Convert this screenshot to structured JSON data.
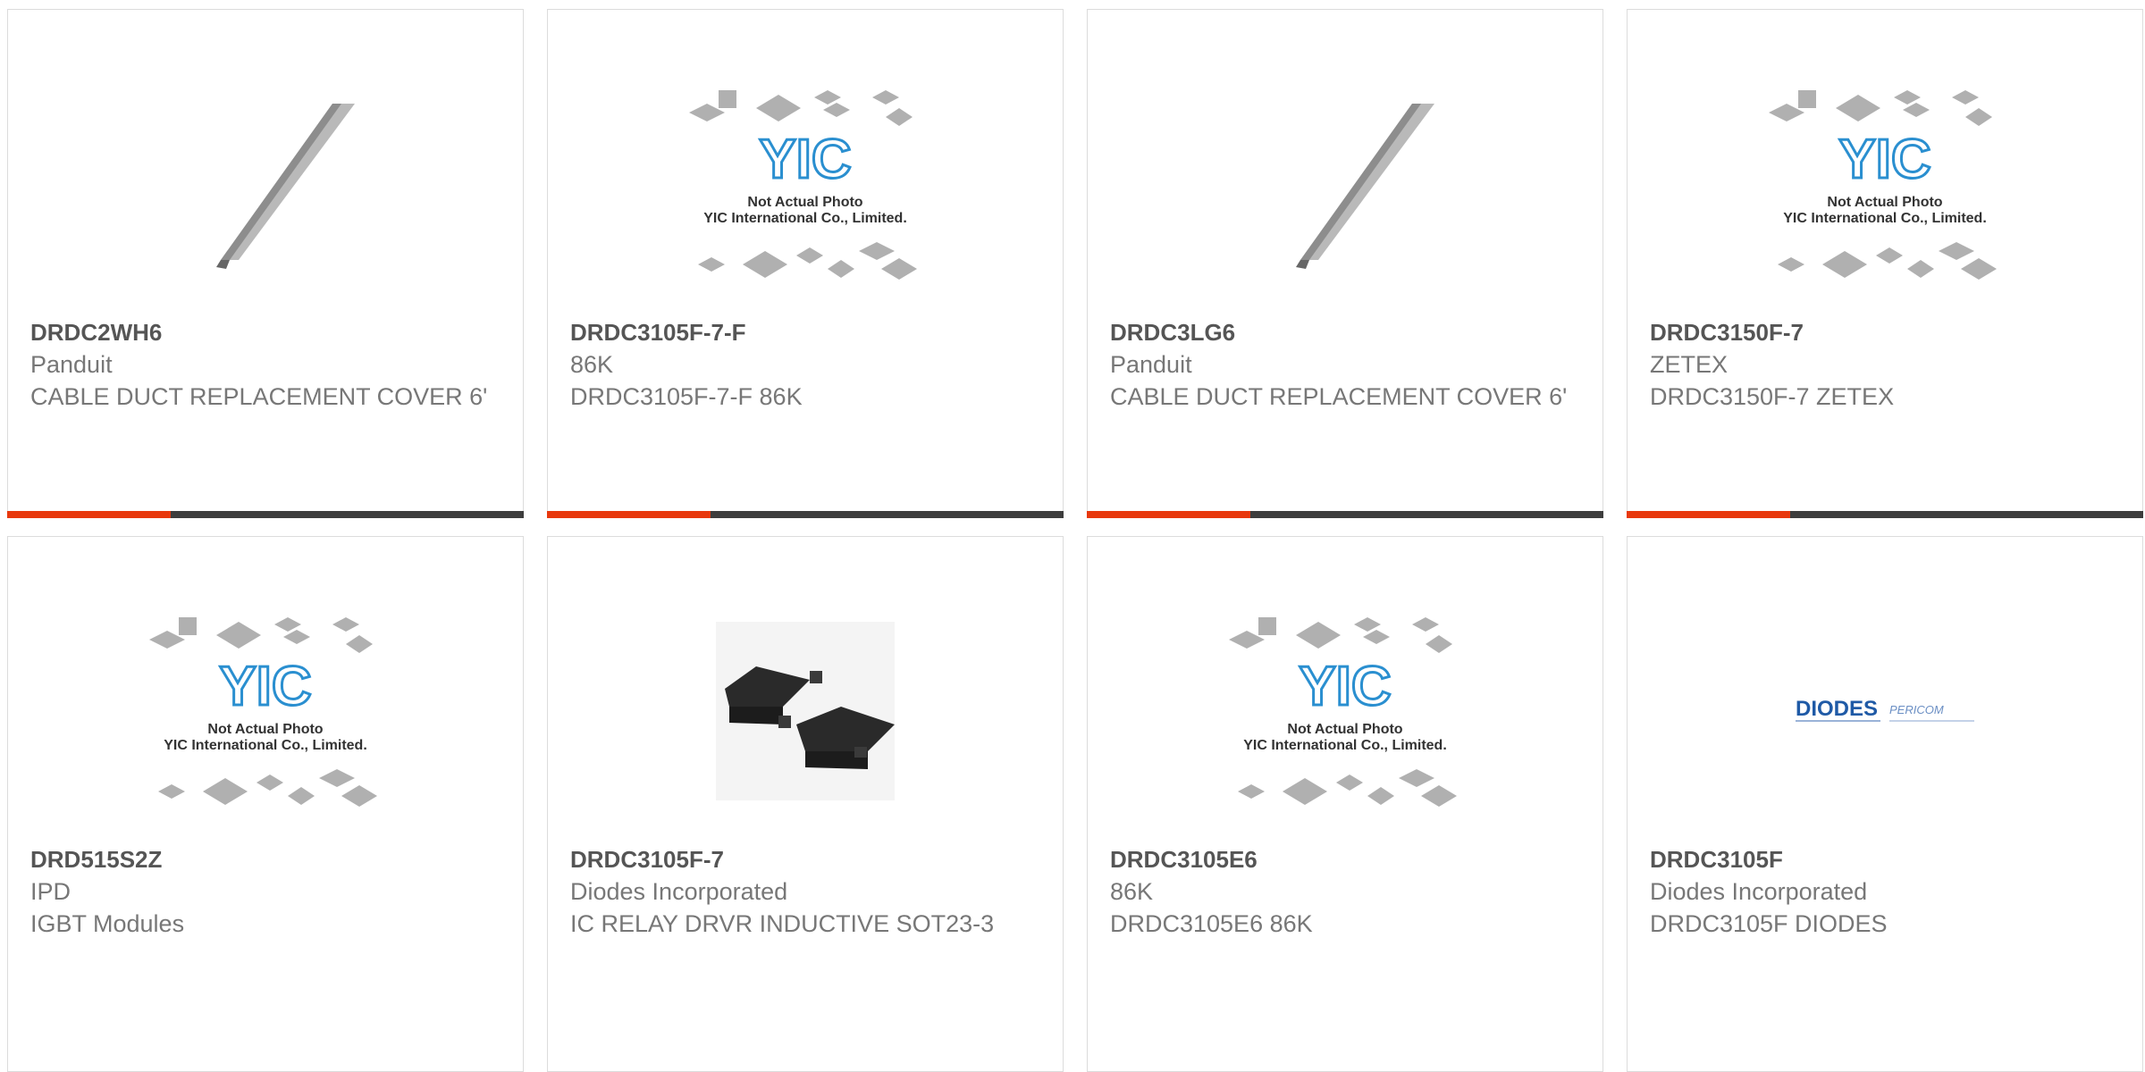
{
  "colors": {
    "accent": "#e8380d",
    "bar": "#3d3d3d",
    "border": "#dcdcdc",
    "text": "#777777",
    "title": "#555555"
  },
  "products": [
    {
      "part": "DRDC2WH6",
      "maker": "Panduit",
      "desc": "CABLE DUCT REPLACEMENT COVER 6'",
      "image": "cable-duct-cover-icon"
    },
    {
      "part": "DRDC3105F-7-F",
      "maker": "86K",
      "desc": "DRDC3105F-7-F 86K",
      "image": "yic-placeholder-icon",
      "placeholder_line1": "Not Actual Photo",
      "placeholder_line2": "YIC International Co., Limited."
    },
    {
      "part": "DRDC3LG6",
      "maker": "Panduit",
      "desc": "CABLE DUCT REPLACEMENT COVER 6'",
      "image": "cable-duct-cover-icon"
    },
    {
      "part": "DRDC3150F-7",
      "maker": "ZETEX",
      "desc": "DRDC3150F-7 ZETEX",
      "image": "yic-placeholder-icon",
      "placeholder_line1": "Not Actual Photo",
      "placeholder_line2": "YIC International Co., Limited."
    },
    {
      "part": "DRD515S2Z",
      "maker": "IPD",
      "desc": "IGBT Modules",
      "image": "yic-placeholder-icon",
      "placeholder_line1": "Not Actual Photo",
      "placeholder_line2": "YIC International Co., Limited."
    },
    {
      "part": "DRDC3105F-7",
      "maker": "Diodes Incorporated",
      "desc": "IC RELAY DRVR INDUCTIVE SOT23-3",
      "image": "sot23-package-icon"
    },
    {
      "part": "DRDC3105E6",
      "maker": "86K",
      "desc": "DRDC3105E6 86K",
      "image": "yic-placeholder-icon",
      "placeholder_line1": "Not Actual Photo",
      "placeholder_line2": "YIC International Co., Limited."
    },
    {
      "part": "DRDC3105F",
      "maker": "Diodes Incorporated",
      "desc": "DRDC3105F DIODES",
      "image": "diodes-logo-icon",
      "logo_text": "DIODES",
      "logo_text2": "PERICOM"
    }
  ]
}
